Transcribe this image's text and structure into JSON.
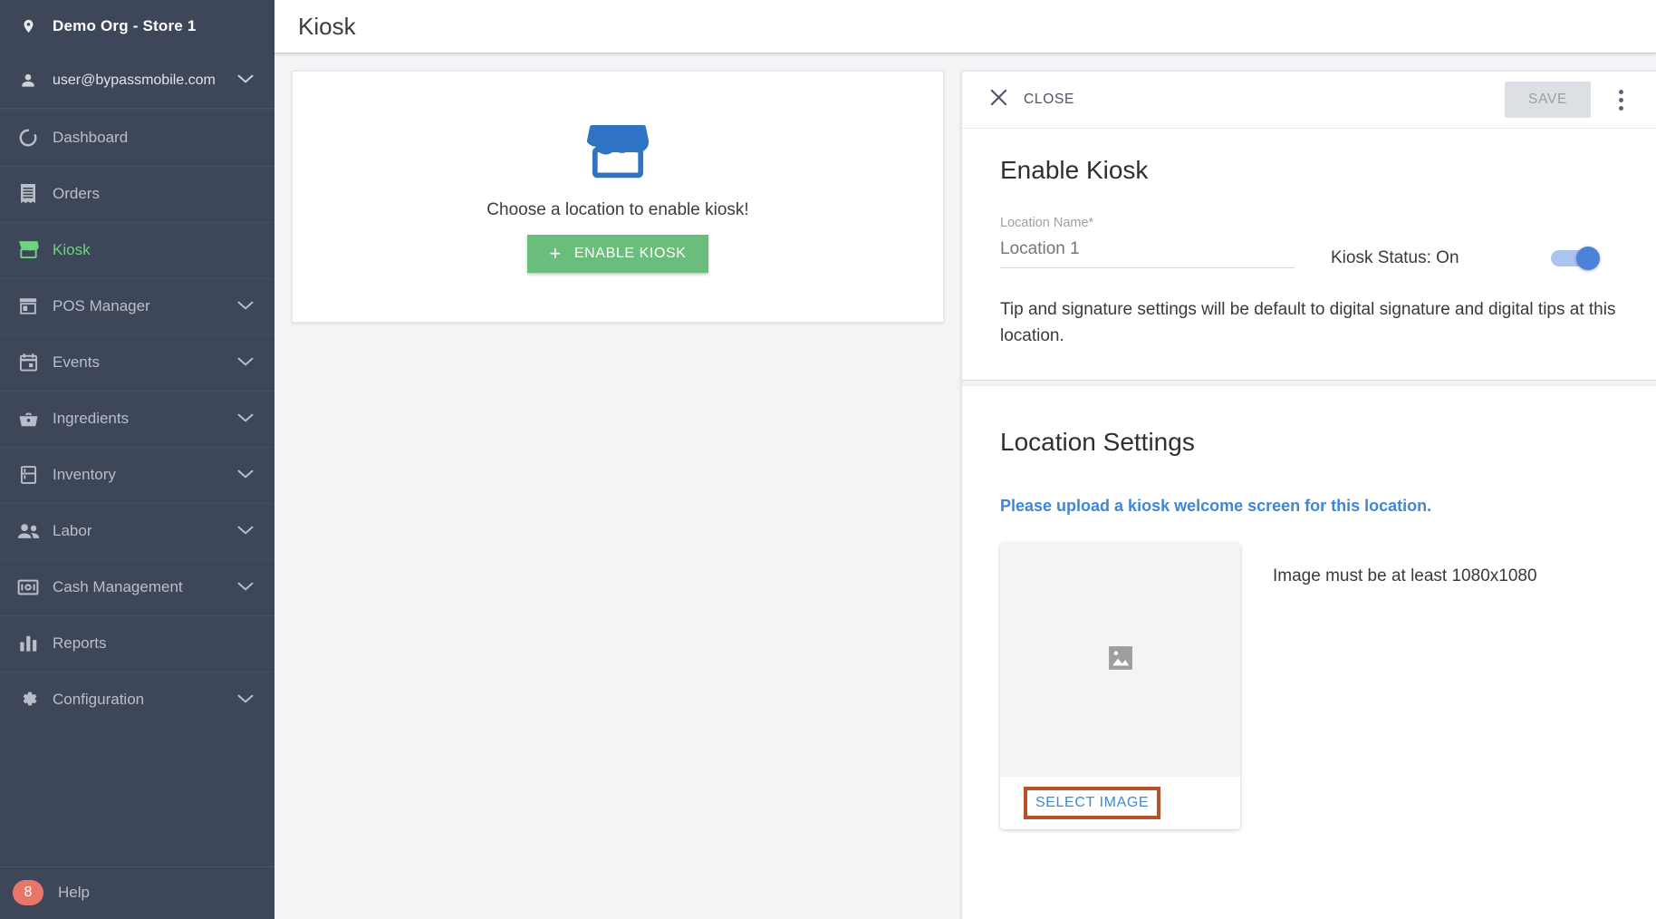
{
  "sidebar": {
    "org": {
      "label": "Demo Org - Store 1",
      "icon": "location-pin-icon"
    },
    "user": {
      "label": "user@bypassmobile.com",
      "icon": "person-icon",
      "chevron": "chevron-down-icon"
    },
    "items": [
      {
        "label": "Dashboard",
        "icon": "dashboard-icon",
        "active": false,
        "expandable": false
      },
      {
        "label": "Orders",
        "icon": "receipt-icon",
        "active": false,
        "expandable": false
      },
      {
        "label": "Kiosk",
        "icon": "storefront-icon",
        "active": true,
        "expandable": false
      },
      {
        "label": "POS Manager",
        "icon": "store-icon",
        "active": false,
        "expandable": true
      },
      {
        "label": "Events",
        "icon": "calendar-icon",
        "active": false,
        "expandable": true
      },
      {
        "label": "Ingredients",
        "icon": "basket-icon",
        "active": false,
        "expandable": true
      },
      {
        "label": "Inventory",
        "icon": "fridge-icon",
        "active": false,
        "expandable": true
      },
      {
        "label": "Labor",
        "icon": "people-icon",
        "active": false,
        "expandable": true
      },
      {
        "label": "Cash Management",
        "icon": "cash-icon",
        "active": false,
        "expandable": true
      },
      {
        "label": "Reports",
        "icon": "bar-chart-icon",
        "active": false,
        "expandable": false
      },
      {
        "label": "Configuration",
        "icon": "gear-icon",
        "active": false,
        "expandable": true
      }
    ],
    "help": {
      "label": "Help",
      "badge": "8"
    }
  },
  "header": {
    "title": "Kiosk"
  },
  "empty_state": {
    "icon": "storefront-icon",
    "message": "Choose a location to enable kiosk!",
    "button_label": "ENABLE KIOSK",
    "button_plus": "+"
  },
  "panel": {
    "close_label": "CLOSE",
    "close_icon": "close-icon",
    "save_label": "SAVE",
    "kebab_icon": "more-vert-icon",
    "enable_kiosk": {
      "title": "Enable Kiosk",
      "location_label": "Location Name*",
      "location_value": "",
      "location_placeholder": "Location 1",
      "toggle_label": "Kiosk Status: On",
      "toggle_state": "on",
      "note": "Tip and signature settings will be default to digital signature and digital tips at this location."
    },
    "location_settings": {
      "title": "Location Settings",
      "upload_prompt": "Please upload a kiosk welcome screen for this location.",
      "preview_icon": "image-placeholder-icon",
      "select_image_label": "SELECT IMAGE",
      "size_note": "Image must be at least 1080x1080"
    }
  },
  "colors": {
    "sidebar_bg": "#3e4759",
    "accent_green": "#6bbd7c",
    "active_green": "#6dd47e",
    "link_blue": "#3f86d6",
    "toggle_blue": "#4b83d8",
    "badge_red": "#e8776a",
    "highlight_orange": "#b8512a",
    "store_icon_blue": "#2f73c4"
  }
}
